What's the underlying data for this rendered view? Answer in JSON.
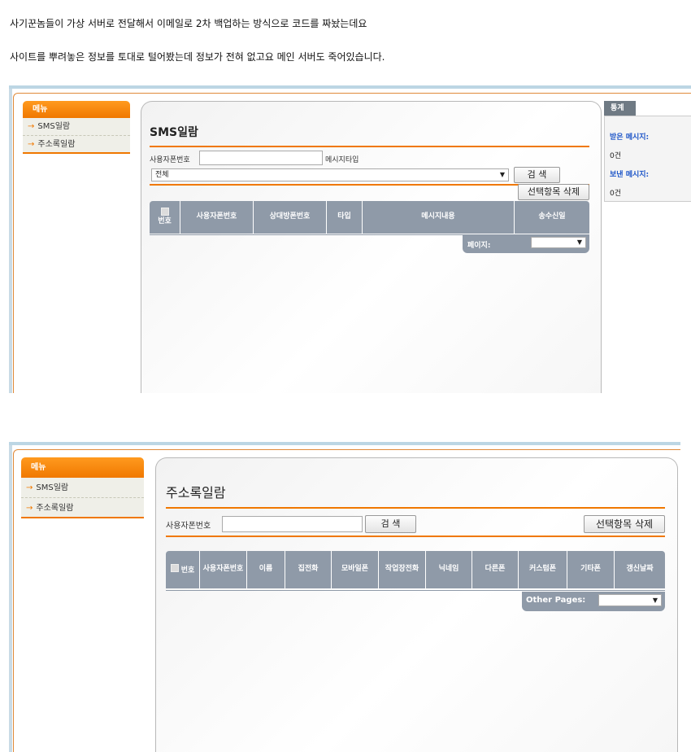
{
  "captions": [
    "사기꾼놈들이 가상 서버로 전달해서 이메일로 2차 백업하는 방식으로 코드를 짜놨는데요",
    "사이트를 뿌려놓은 정보를 토대로 털어봤는데 정보가 전혀 없고요 메인 서버도 죽어있습니다."
  ],
  "menu": {
    "header": "메뉴",
    "items": [
      "SMS일람",
      "주소록일람"
    ],
    "arrow": "→"
  },
  "sms": {
    "title": "SMS일람",
    "phone_label": "사용자폰번호",
    "phone_value": "",
    "type_label": "메시지타입",
    "type_selected": "전체",
    "search_button": "검  색",
    "delete_button": "선택항목 삭제",
    "columns": [
      "번호",
      "사용자폰번호",
      "상대방폰번호",
      "타입",
      "메시지내용",
      "송수신일"
    ],
    "page_label": "페이지:",
    "page_selected": ""
  },
  "stats": {
    "tab": "통계",
    "received_label": "받은 메시지:",
    "received_value": "0건",
    "sent_label": "보낸 메시지:",
    "sent_value": "0건"
  },
  "contacts": {
    "title": "주소록일람",
    "phone_label": "사용자폰번호",
    "phone_value": "",
    "search_button": "검  색",
    "delete_button": "선택항목 삭제",
    "columns": [
      "번호",
      "사용자폰번호",
      "이름",
      "집전화",
      "모바일폰",
      "작업장전화",
      "닉네임",
      "다른폰",
      "커스텀폰",
      "기타폰",
      "갱신날짜"
    ],
    "page_label": "Other Pages:",
    "page_selected": ""
  },
  "colors": {
    "accent": "#f07800",
    "table_header": "#8f9aa8",
    "frame_top": "#bcd6e4",
    "link_blue": "#1d55c8"
  },
  "icons": {
    "dropdown": "chevron-down-icon",
    "menu_arrow": "arrow-right-icon",
    "checkbox": "checkbox-icon"
  }
}
